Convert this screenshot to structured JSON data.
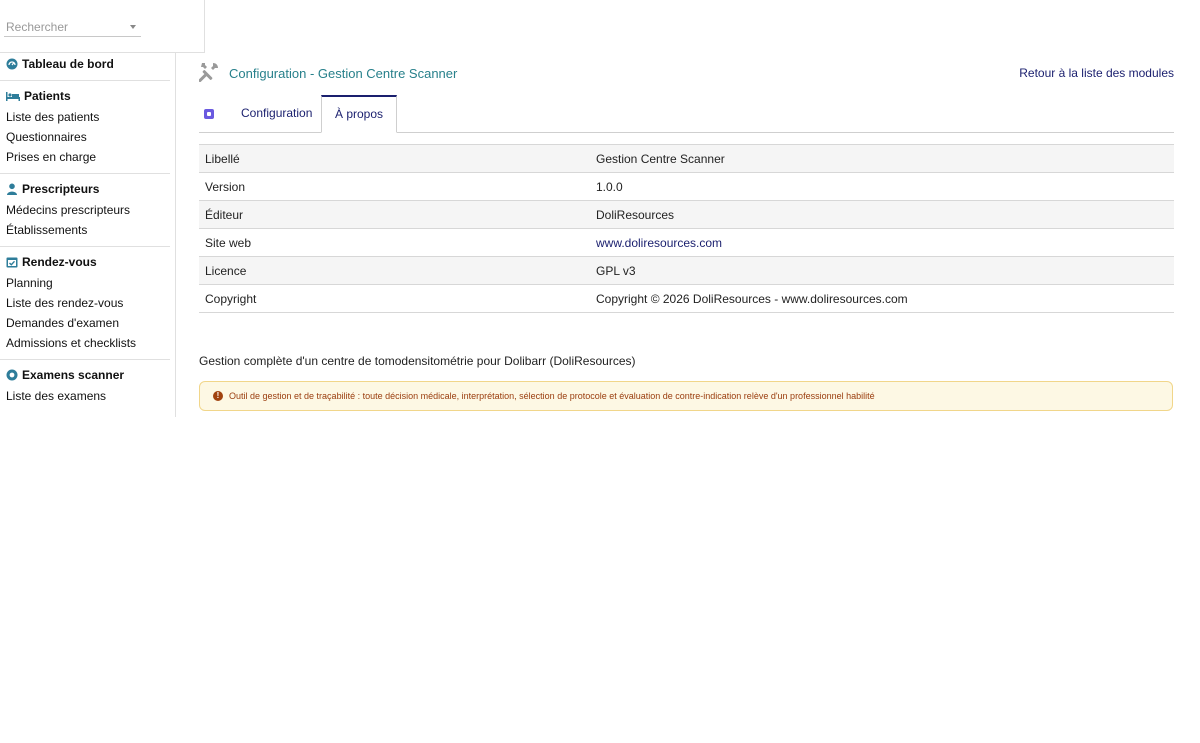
{
  "search": {
    "placeholder": "Rechercher"
  },
  "sidebar": {
    "dashboard": "Tableau de bord",
    "patients": {
      "title": "Patients",
      "items": [
        "Liste des patients",
        "Questionnaires",
        "Prises en charge"
      ]
    },
    "prescripteurs": {
      "title": "Prescripteurs",
      "items": [
        "Médecins prescripteurs",
        "Établissements"
      ]
    },
    "rendezvous": {
      "title": "Rendez-vous",
      "items": [
        "Planning",
        "Liste des rendez-vous",
        "Demandes d'examen",
        "Admissions et checklists"
      ]
    },
    "examens": {
      "title": "Examens scanner",
      "items": [
        "Liste des examens"
      ]
    }
  },
  "header": {
    "title": "Configuration - Gestion Centre Scanner",
    "back_link": "Retour à la liste des modules"
  },
  "tabs": [
    {
      "label": "Configuration",
      "active": false
    },
    {
      "label": "À propos",
      "active": true
    }
  ],
  "info": {
    "rows": [
      {
        "key": "Libellé",
        "value": "Gestion Centre Scanner"
      },
      {
        "key": "Version",
        "value": "1.0.0"
      },
      {
        "key": "Éditeur",
        "value": "DoliResources"
      },
      {
        "key": "Site web",
        "value": "www.doliresources.com"
      },
      {
        "key": "Licence",
        "value": "GPL v3"
      },
      {
        "key": "Copyright",
        "value": "Copyright © 2026 DoliResources - www.doliresources.com"
      }
    ]
  },
  "description": "Gestion complète d'un centre de tomodensitométrie pour Dolibarr (DoliResources)",
  "warning": "Outil de gestion et de traçabilité : toute décision médicale, interprétation, sélection de protocole et évaluation de contre-indication relève d'un professionnel habilité",
  "colors": {
    "accent": "#27808b",
    "link": "#1a1f6e",
    "warning_bg": "#fdf8e4",
    "warning_border": "#f1d68a"
  }
}
